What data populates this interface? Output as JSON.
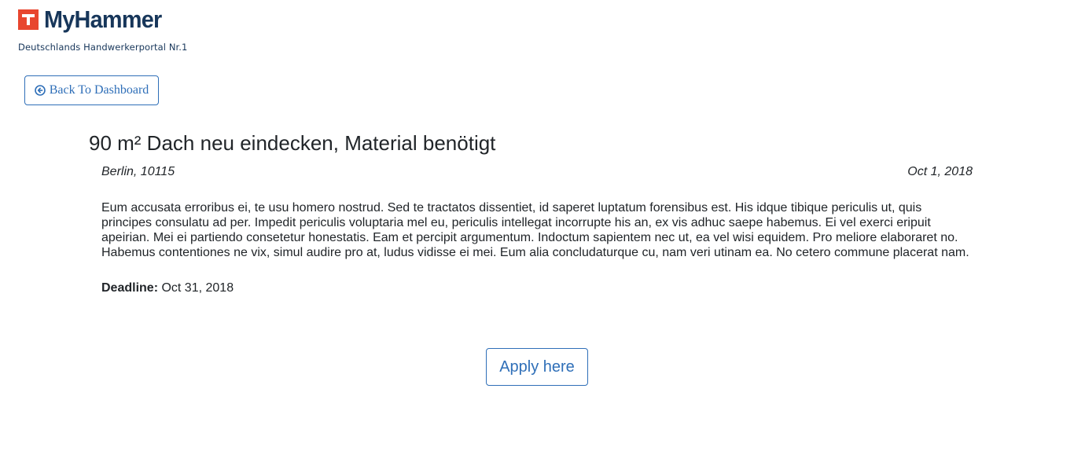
{
  "brand": {
    "name": "MyHammer",
    "tagline": "Deutschlands Handwerkerportal Nr.1",
    "colors": {
      "logo_red": "#e8462f",
      "logo_navy": "#17365a",
      "link_blue": "#2f6fb8"
    }
  },
  "nav": {
    "back_label": "Back To Dashboard",
    "back_icon": "arrow-circle-left-icon"
  },
  "job": {
    "title": "90 m² Dach neu eindecken, Material benötigt",
    "location": "Berlin, 10115",
    "date": "Oct 1, 2018",
    "description": "Eum accusata erroribus ei, te usu homero nostrud. Sed te tractatos dissentiet, id saperet luptatum forensibus est. His idque tibique periculis ut, quis principes consulatu ad per. Impedit periculis voluptaria mel eu, periculis intellegat incorrupte his an, ex vis adhuc saepe habemus. Ei vel exerci eripuit apeirian. Mei ei partiendo consetetur honestatis. Eam et percipit argumentum. Indoctum sapientem nec ut, ea vel wisi equidem. Pro meliore elaboraret no. Habemus contentiones ne vix, simul audire pro at, ludus vidisse ei mei. Eum alia concludaturque cu, nam veri utinam ea. No cetero commune placerat nam.",
    "deadline_label": "Deadline:",
    "deadline_value": "Oct 31, 2018"
  },
  "actions": {
    "apply_label": "Apply here"
  }
}
